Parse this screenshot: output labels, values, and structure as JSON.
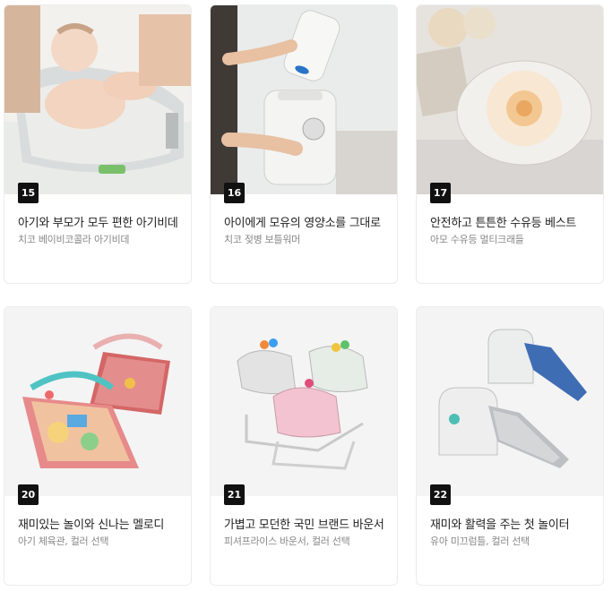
{
  "cards": [
    {
      "num": "15",
      "title": "아기와 부모가 모두 편한 아기비데",
      "sub": "치코 베이비코콜라 아기비데",
      "image": "baby-bidet-photo"
    },
    {
      "num": "16",
      "title": "아이에게 모유의 영양소를 그대로",
      "sub": "치코 젖병 보틀워머",
      "image": "bottle-warmer-photo"
    },
    {
      "num": "17",
      "title": "안전하고 튼튼한 수유등 베스트",
      "sub": "아모 수유등 멀티크래들",
      "image": "nursing-light-photo"
    },
    {
      "num": "20",
      "title": "재미있는 놀이와 신나는 멜로디",
      "sub": "아기 체육관, 컬러 선택",
      "image": "baby-gym-photo"
    },
    {
      "num": "21",
      "title": "가볍고 모던한 국민 브랜드 바운서",
      "sub": "피셔프라이스 바운서, 컬러 선택",
      "image": "bouncer-photo"
    },
    {
      "num": "22",
      "title": "재미와 활력을 주는 첫 놀이터",
      "sub": "유아 미끄럼틀, 컬러 선택",
      "image": "slide-photo"
    }
  ]
}
